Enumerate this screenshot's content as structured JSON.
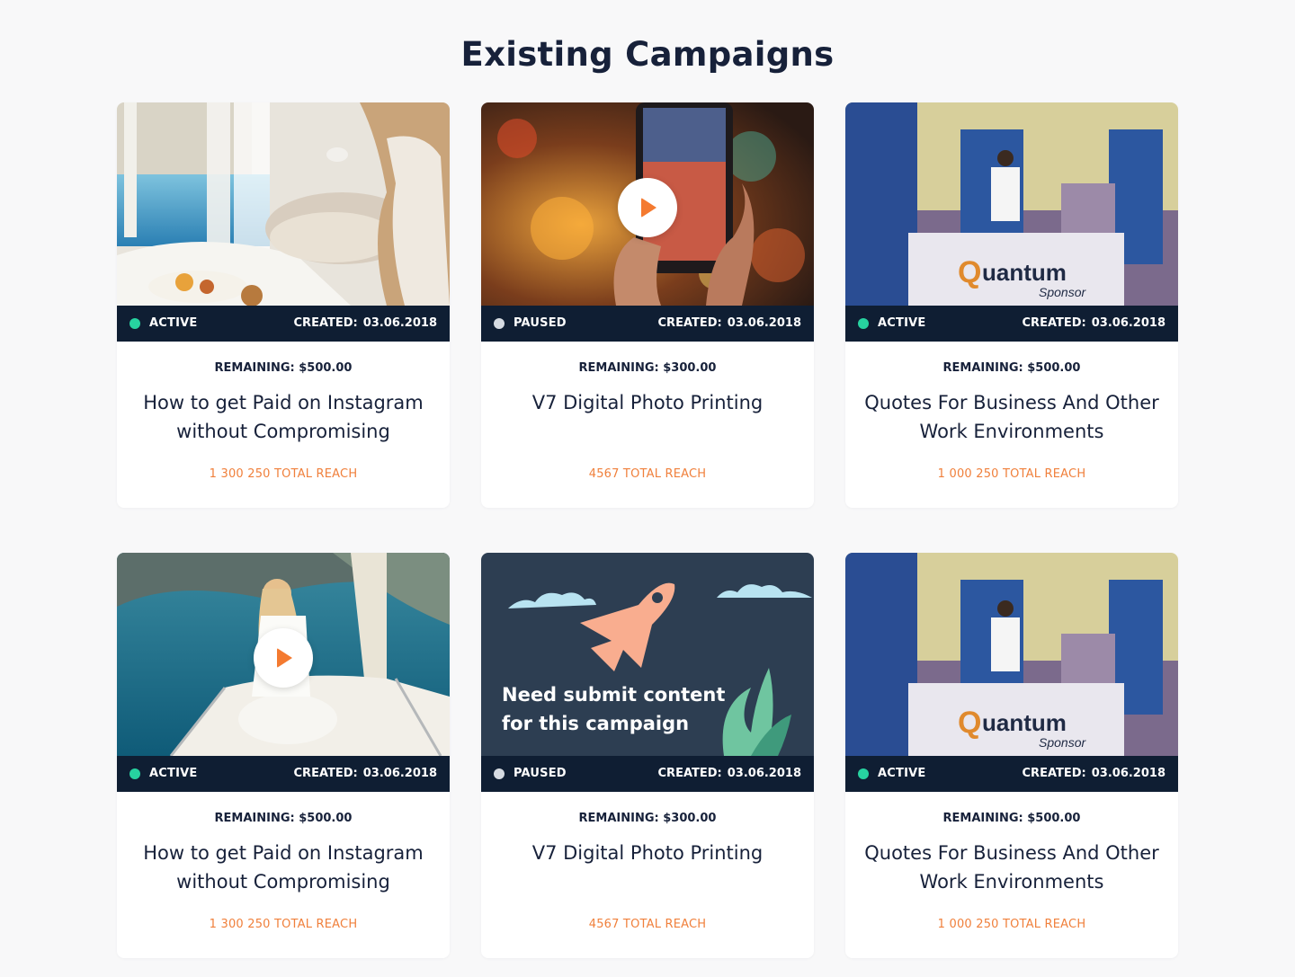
{
  "page": {
    "title": "Existing Campaigns"
  },
  "colors": {
    "active": "#27d2a0",
    "paused": "#d6dbe2",
    "accent": "#f47a30",
    "bar": "#0f1e33"
  },
  "created_label": "CREATED:",
  "cards": [
    {
      "image": "bed-breakfast-photo",
      "status": "ACTIVE",
      "created": "03.06.2018",
      "remaining": "REMAINING: $500.00",
      "title": "How to get Paid on Instagram without Compromising",
      "reach": "1 300 250 TOTAL REACH",
      "video": false
    },
    {
      "image": "phone-photo",
      "status": "PAUSED",
      "created": "03.06.2018",
      "remaining": "REMAINING: $300.00",
      "title": "V7 Digital Photo Printing",
      "reach": "4567 TOTAL REACH",
      "video": true
    },
    {
      "image": "quantum-booth-photo",
      "status": "ACTIVE",
      "created": "03.06.2018",
      "remaining": "REMAINING: $500.00",
      "title": "Quotes For Business And Other Work Environments",
      "reach": "1 000 250 TOTAL REACH",
      "video": false
    },
    {
      "image": "boat-photo",
      "status": "ACTIVE",
      "created": "03.06.2018",
      "remaining": "REMAINING: $500.00",
      "title": "How to get Paid on Instagram without Compromising",
      "reach": "1 300 250 TOTAL REACH",
      "video": true
    },
    {
      "image": "rocket-illustration",
      "status": "PAUSED",
      "created": "03.06.2018",
      "remaining": "REMAINING: $300.00",
      "title": "V7 Digital Photo Printing",
      "reach": "4567 TOTAL REACH",
      "video": false,
      "promo_text": "Need submit content for this campaign"
    },
    {
      "image": "quantum-booth-photo",
      "status": "ACTIVE",
      "created": "03.06.2018",
      "remaining": "REMAINING: $500.00",
      "title": "Quotes For Business And Other Work Environments",
      "reach": "1 000 250 TOTAL REACH",
      "video": false
    }
  ]
}
